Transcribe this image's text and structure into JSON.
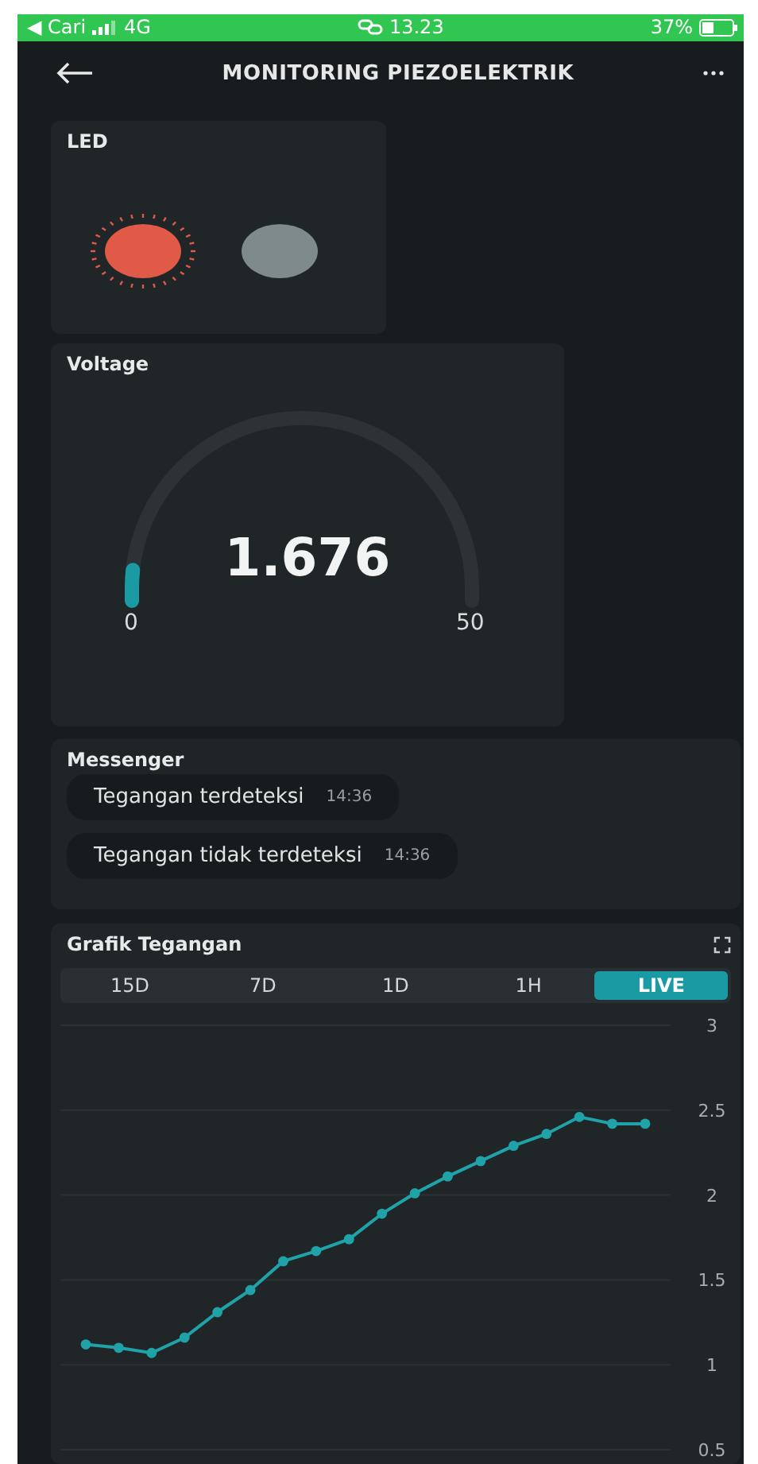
{
  "status_bar": {
    "back_app": "◀ Cari",
    "network": "4G",
    "time": "13.23",
    "battery": "37%"
  },
  "header": {
    "title": "MONITORING PIEZOELEKTRIK"
  },
  "led_card": {
    "title": "LED",
    "leds": [
      {
        "on": true,
        "color": "#e05a47"
      },
      {
        "on": false,
        "color": "#7f8b8a"
      }
    ]
  },
  "voltage_card": {
    "title": "Voltage",
    "value": "1.676",
    "level": 0.034,
    "min": "0",
    "max": "50"
  },
  "messenger": {
    "title": "Messenger",
    "messages": [
      {
        "text": "Tegangan terdeteksi",
        "time": "14:36"
      },
      {
        "text": "Tegangan tidak terdeteksi",
        "time": "14:36"
      }
    ]
  },
  "chart_card": {
    "title": "Grafik Tegangan",
    "ranges": [
      {
        "label": "15D",
        "selected": false
      },
      {
        "label": "7D",
        "selected": false
      },
      {
        "label": "1D",
        "selected": false
      },
      {
        "label": "1H",
        "selected": false
      },
      {
        "label": "LIVE",
        "selected": true
      }
    ],
    "chart_data": {
      "type": "line",
      "categories": [
        null,
        null,
        null,
        null,
        null,
        null,
        null,
        null,
        null,
        null,
        null,
        null,
        null,
        null,
        null,
        null,
        null,
        null
      ],
      "ylim": [
        0.5,
        3
      ],
      "yticks": [
        0.5,
        1,
        1.5,
        2,
        2.5,
        3
      ],
      "grid": true,
      "series": [
        {
          "marker": "circle",
          "color": "#1fa3a8",
          "values": [
            1.12,
            1.1,
            1.07,
            1.16,
            1.31,
            1.44,
            1.61,
            1.67,
            1.74,
            1.89,
            2.01,
            2.11,
            2.2,
            2.29,
            2.36,
            2.46,
            2.42,
            2.42
          ]
        }
      ]
    }
  }
}
